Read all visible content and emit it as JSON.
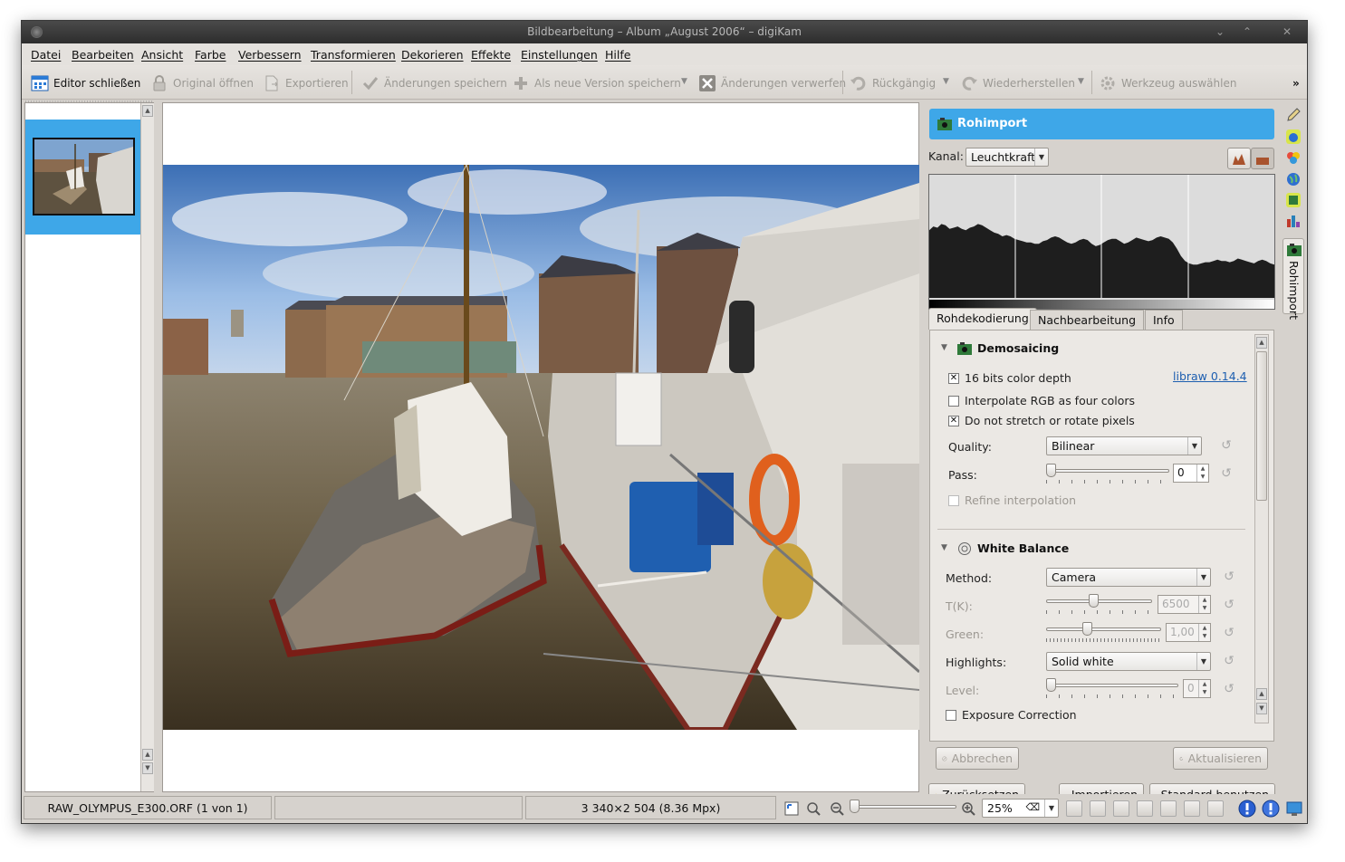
{
  "window": {
    "title": "Bildbearbeitung – Album „August 2006“ – digiKam",
    "controls": [
      "⌄",
      "⌃",
      "✕"
    ]
  },
  "menu": [
    "Datei",
    "Bearbeiten",
    "Ansicht",
    "Farbe",
    "Verbessern",
    "Transformieren",
    "Dekorieren",
    "Effekte",
    "Einstellungen",
    "Hilfe"
  ],
  "toolbar": {
    "close_editor": "Editor schließen",
    "open_original": "Original öffnen",
    "export": "Exportieren",
    "save_changes": "Änderungen speichern",
    "save_as_version": "Als neue Version speichern",
    "discard_changes": "Änderungen verwerfen",
    "undo": "Rückgängig",
    "redo": "Wiederherstellen",
    "choose_tool": "Werkzeug auswählen",
    "more": "»"
  },
  "panel": {
    "title": "Rohimport",
    "channel_label": "Kanal:",
    "channel_value": "Leuchtkraft",
    "tabs": [
      "Rohdekodierung",
      "Nachbearbeitung",
      "Info"
    ],
    "demosaicing": {
      "header": "Demosaicing",
      "bits": "16 bits color depth",
      "libraw": "libraw 0.14.4",
      "interpolate": "Interpolate RGB as four colors",
      "no_stretch": "Do not stretch or rotate pixels",
      "quality_label": "Quality:",
      "quality_value": "Bilinear",
      "pass_label": "Pass:",
      "pass_value": "0",
      "refine": "Refine interpolation"
    },
    "white_balance": {
      "header": "White Balance",
      "method_label": "Method:",
      "method_value": "Camera",
      "tk_label": "T(K):",
      "tk_value": "6500",
      "green_label": "Green:",
      "green_value": "1,00",
      "highlights_label": "Highlights:",
      "highlights_value": "Solid white",
      "level_label": "Level:",
      "level_value": "0",
      "exposure_label": "Exposure Correction"
    },
    "buttons": {
      "cancel": "Abbrechen",
      "update": "Aktualisieren",
      "reset": "Zurücksetzen",
      "import": "Importieren",
      "default": "Standard benutzen"
    },
    "side_tab": "Rohimport"
  },
  "status": {
    "filename": "RAW_OLYMPUS_E300.ORF (1 von 1)",
    "dimensions": "3 340×2 504 (8.36 Mpx)",
    "zoom": "25%"
  },
  "histogram_levels": [
    0.55,
    0.58,
    0.57,
    0.6,
    0.59,
    0.56,
    0.57,
    0.58,
    0.56,
    0.55,
    0.57,
    0.58,
    0.6,
    0.59,
    0.57,
    0.55,
    0.53,
    0.52,
    0.5,
    0.51,
    0.5,
    0.48,
    0.47,
    0.46,
    0.45,
    0.45,
    0.44,
    0.44,
    0.46,
    0.47,
    0.49,
    0.5,
    0.49,
    0.47,
    0.45,
    0.44,
    0.45,
    0.47,
    0.48,
    0.47,
    0.44,
    0.42,
    0.43,
    0.45,
    0.47,
    0.48,
    0.48,
    0.46,
    0.44,
    0.45,
    0.47,
    0.49,
    0.48,
    0.47,
    0.46,
    0.47,
    0.49,
    0.5,
    0.49,
    0.48,
    0.45,
    0.4,
    0.34,
    0.3,
    0.28,
    0.27,
    0.27,
    0.28,
    0.29,
    0.29,
    0.3,
    0.31,
    0.3,
    0.3,
    0.29,
    0.3,
    0.32,
    0.31,
    0.3,
    0.29,
    0.28,
    0.3,
    0.31,
    0.3,
    0.28,
    0.27
  ]
}
